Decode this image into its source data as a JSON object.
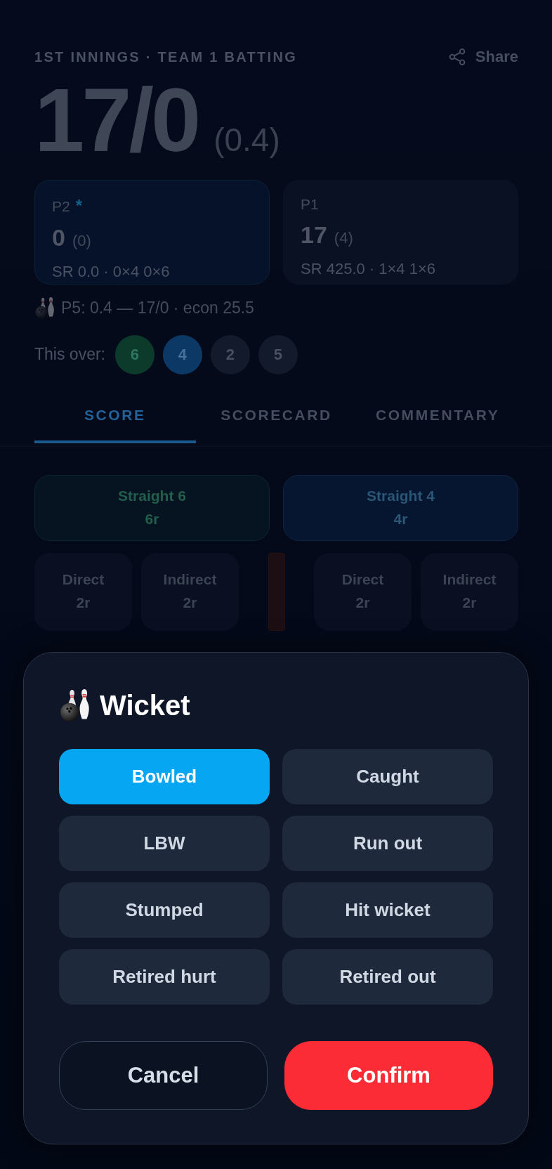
{
  "header": {
    "innings": "1ST INNINGS · TEAM 1 BATTING",
    "share": "Share"
  },
  "score": {
    "total": "17/0",
    "overs": "(0.4)"
  },
  "batters": [
    {
      "name": "P2",
      "strike_mark": "*",
      "on_strike": true,
      "runs": "0",
      "balls": "(0)",
      "stats": "SR 0.0 · 0×4 0×6"
    },
    {
      "name": "P1",
      "on_strike": false,
      "runs": "17",
      "balls": "(4)",
      "stats": "SR 425.0 · 1×4 1×6"
    }
  ],
  "bowler": {
    "figures": "P5: 0.4 — 17/0 · econ 25.5"
  },
  "this_over": {
    "label": "This over:",
    "balls": [
      {
        "label": "6",
        "kind": "six"
      },
      {
        "label": "4",
        "kind": "four"
      },
      {
        "label": "2",
        "kind": "run"
      },
      {
        "label": "5",
        "kind": "run"
      }
    ]
  },
  "tabs": [
    {
      "label": "SCORE",
      "selected": true
    },
    {
      "label": "SCORECARD",
      "selected": false
    },
    {
      "label": "COMMENTARY",
      "selected": false
    }
  ],
  "shots": {
    "straight": [
      {
        "label": "Straight 6",
        "runs": "6r",
        "kind": "six"
      },
      {
        "label": "Straight 4",
        "runs": "4r",
        "kind": "four"
      }
    ],
    "left": [
      {
        "label": "Direct",
        "runs": "2r"
      },
      {
        "label": "Indirect",
        "runs": "2r"
      }
    ],
    "right": [
      {
        "label": "Direct",
        "runs": "2r"
      },
      {
        "label": "Indirect",
        "runs": "2r"
      }
    ]
  },
  "dialog": {
    "title": "Wicket",
    "options": [
      {
        "label": "Bowled",
        "selected": true
      },
      {
        "label": "Caught",
        "selected": false
      },
      {
        "label": "LBW",
        "selected": false
      },
      {
        "label": "Run out",
        "selected": false
      },
      {
        "label": "Stumped",
        "selected": false
      },
      {
        "label": "Hit wicket",
        "selected": false
      },
      {
        "label": "Retired hurt",
        "selected": false
      },
      {
        "label": "Retired out",
        "selected": false
      }
    ],
    "actions": [
      {
        "label": "Cancel",
        "kind": "secondary"
      },
      {
        "label": "Confirm",
        "kind": "danger"
      }
    ]
  }
}
